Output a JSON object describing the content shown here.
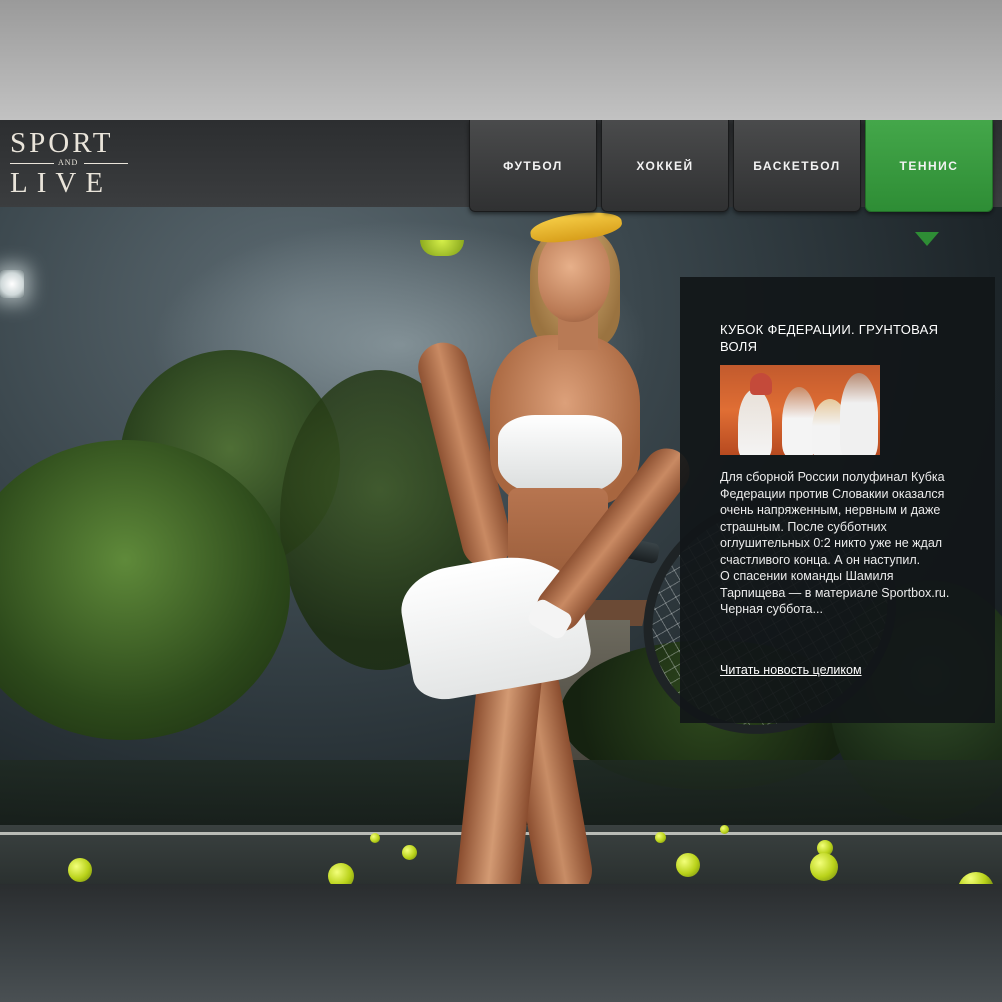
{
  "brand": {
    "logo_line1": "SPORT",
    "logo_and": "AND",
    "logo_line2": "LIVE"
  },
  "nav": {
    "items": [
      {
        "label": "ФУТБОЛ",
        "active": false
      },
      {
        "label": "ХОККЕЙ",
        "active": false
      },
      {
        "label": "БАСКЕТБОЛ",
        "active": false
      },
      {
        "label": "ТЕННИС",
        "active": true
      }
    ],
    "active_color": "#3a9c40"
  },
  "news": {
    "title": "КУБОК ФЕДЕРАЦИИ. ГРУНТОВАЯ ВОЛЯ",
    "paragraph_lines": [
      "Для сборной России полуфинал Кубка",
      "Федерации против Словакии оказался",
      "очень напряженным, нервным и даже",
      "страшным. После субботних",
      "оглушительных 0:2 никто уже не ждал",
      "счастливого конца. А он наступил.",
      "О спасении команды Шамиля",
      "Тарпищева — в материале Sportbox.ru.",
      "Черная суббота..."
    ],
    "read_more": "Читать новость целиком"
  },
  "hero": {
    "subject": "tennis player",
    "ball_color": "#c7dc2a"
  }
}
